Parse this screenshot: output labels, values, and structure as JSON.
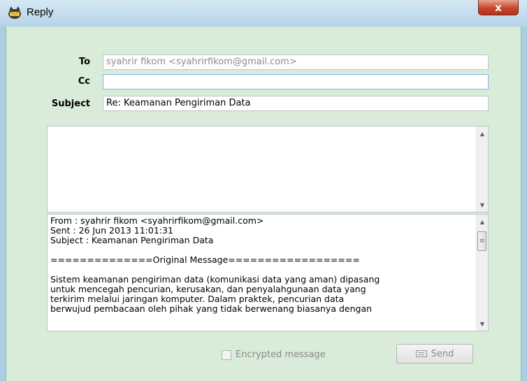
{
  "window": {
    "title": "Reply",
    "close_label": "x"
  },
  "form": {
    "to_label": "To",
    "to_value": "syahrir fikom <syahrirfikom@gmail.com>",
    "cc_label": "Cc",
    "cc_value": "",
    "subject_label": "Subject",
    "subject_value": "Re: Keamanan Pengiriman Data"
  },
  "quoted_message": {
    "from": "From : syahrir fikom <syahrirfikom@gmail.com>",
    "sent": "Sent : 26 Jun 2013 11:01:31",
    "subject": "Subject : Keamanan Pengiriman Data",
    "separator": "==============Original Message==================",
    "line1": "Sistem keamanan pengiriman data (komunikasi data yang aman) dipasang",
    "line2": "untuk mencegah pencurian, kerusakan, dan penyalahgunaan data yang",
    "line3": "terkirim melalui jaringan komputer. Dalam praktek, pencurian data",
    "line4": "berwujud pembacaan oleh pihak yang tidak berwenang biasanya dengan"
  },
  "footer": {
    "encrypted_label": "Encrypted message",
    "encrypted_checked": false,
    "send_label": "Send"
  },
  "icons": {
    "app": "cat-mail-icon",
    "send": "keyboard-send-icon"
  },
  "colors": {
    "client_background": "#d8ecd9",
    "title_background": "#b5d3e8",
    "close_button": "#c8452d"
  }
}
